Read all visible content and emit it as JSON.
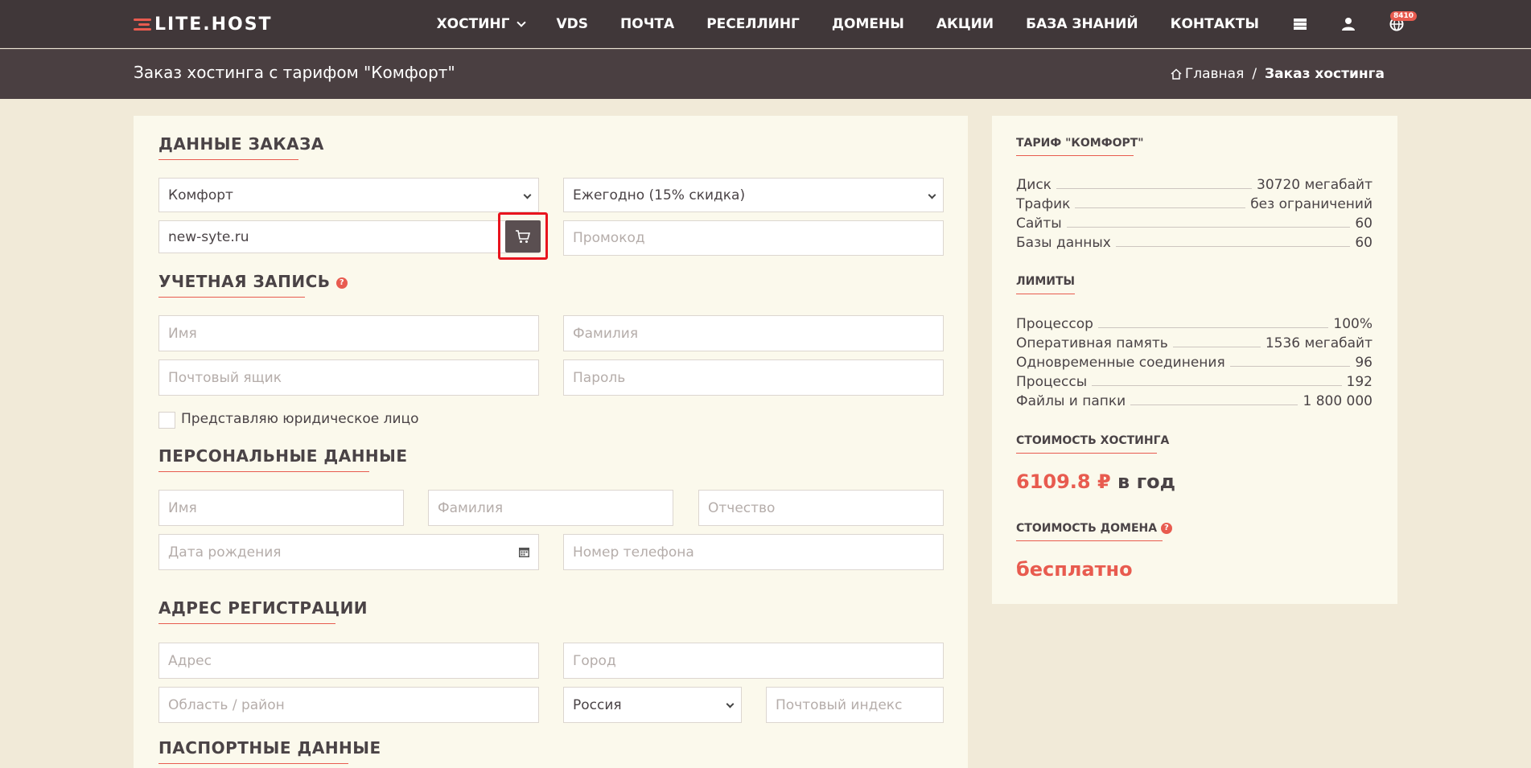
{
  "header": {
    "logo": "LITE.HOST",
    "nav": [
      "ХОСТИНГ",
      "VDS",
      "ПОЧТА",
      "РЕСЕЛЛИНГ",
      "ДОМЕНЫ",
      "АКЦИИ",
      "БАЗА ЗНАНИЙ",
      "КОНТАКТЫ"
    ],
    "badge": "8410",
    "icons": [
      "server-icon",
      "user-icon",
      "globe-icon"
    ]
  },
  "subheader": {
    "title": "Заказ хостинга с тарифом \"Комфорт\"",
    "breadcrumb_home": "Главная",
    "breadcrumb_sep": "/",
    "breadcrumb_current": "Заказ хостинга"
  },
  "order": {
    "heading": "ДАННЫЕ ЗАКАЗА",
    "plan_value": "Комфорт",
    "period_value": "Ежегодно (15% скидка)",
    "domain_value": "new-syte.ru",
    "promo_placeholder": "Промокод"
  },
  "account": {
    "heading": "УЧЕТНАЯ ЗАПИСЬ",
    "first_name_placeholder": "Имя",
    "last_name_placeholder": "Фамилия",
    "email_placeholder": "Почтовый ящик",
    "password_placeholder": "Пароль",
    "legal_entity_label": "Представляю юридическое лицо"
  },
  "personal": {
    "heading": "ПЕРСОНАЛЬНЫЕ ДАННЫЕ",
    "first_name_placeholder": "Имя",
    "last_name_placeholder": "Фамилия",
    "middle_name_placeholder": "Отчество",
    "birthdate_placeholder": "Дата рождения",
    "phone_placeholder": "Номер телефона"
  },
  "address": {
    "heading": "АДРЕС РЕГИСТРАЦИИ",
    "address_placeholder": "Адрес",
    "city_placeholder": "Город",
    "region_placeholder": "Область / район",
    "country_value": "Россия",
    "zip_placeholder": "Почтовый индекс"
  },
  "passport": {
    "heading": "ПАСПОРТНЫЕ ДАННЫЕ"
  },
  "sidebar": {
    "tariff_heading": "ТАРИФ \"КОМФОРТ\"",
    "tariff_rows": [
      {
        "label": "Диск",
        "value": "30720 мегабайт"
      },
      {
        "label": "Трафик",
        "value": "без ограничений"
      },
      {
        "label": "Сайты",
        "value": "60"
      },
      {
        "label": "Базы данных",
        "value": "60"
      }
    ],
    "limits_heading": "ЛИМИТЫ",
    "limit_rows": [
      {
        "label": "Процессор",
        "value": "100%"
      },
      {
        "label": "Оперативная память",
        "value": "1536 мегабайт"
      },
      {
        "label": "Одновременные соединения",
        "value": "96"
      },
      {
        "label": "Процессы",
        "value": "192"
      },
      {
        "label": "Файлы и папки",
        "value": "1 800 000"
      }
    ],
    "cost_heading": "СТОИМОСТЬ ХОСТИНГА",
    "cost_amount": "6109.8 ₽",
    "cost_period": "в год",
    "domain_cost_heading": "СТОИМОСТЬ ДОМЕНА",
    "domain_cost_value": "бесплатно"
  },
  "colors": {
    "accent": "#e85b4f",
    "header_bg": "#403739",
    "page_bg": "#f1ead8",
    "card_bg": "#fbf9ec"
  }
}
